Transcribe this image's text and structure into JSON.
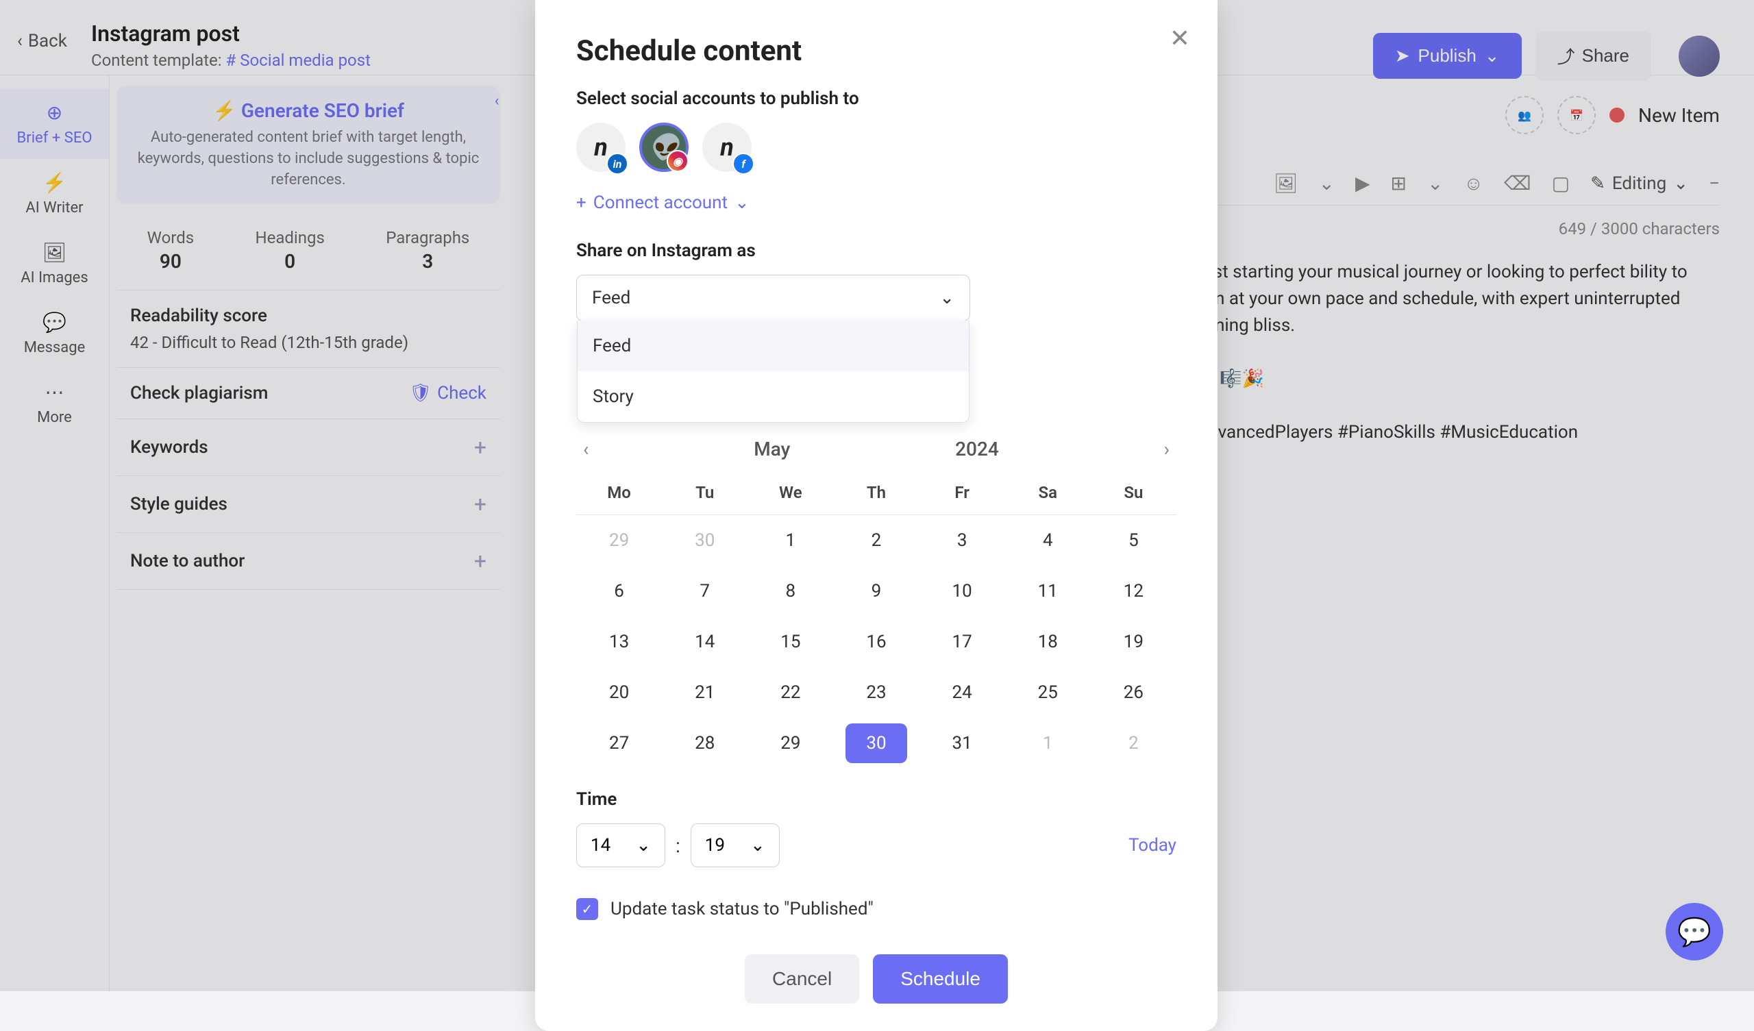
{
  "topbar": {
    "back": "Back",
    "title": "Instagram post",
    "template_label": "Content template:",
    "template_name": "# Social media post",
    "publish": "Publish",
    "share": "Share"
  },
  "left_sidebar": {
    "items": [
      {
        "label": "Brief + SEO"
      },
      {
        "label": "AI Writer"
      },
      {
        "label": "AI Images"
      },
      {
        "label": "Message"
      },
      {
        "label": "More"
      }
    ]
  },
  "seo_panel": {
    "generate_title": "Generate SEO brief",
    "generate_desc": "Auto-generated content brief with target length, keywords, questions to include suggestions & topic references.",
    "stats": {
      "words_label": "Words",
      "words_value": "90",
      "headings_label": "Headings",
      "headings_value": "0",
      "paragraphs_label": "Paragraphs",
      "paragraphs_value": "3"
    },
    "readability_title": "Readability score",
    "readability_text": "42 - Difficult to Read (12th-15th grade)",
    "plagiarism_title": "Check plagiarism",
    "plagiarism_action": "Check",
    "keywords_title": "Keywords",
    "style_title": "Style guides",
    "note_title": "Note to author"
  },
  "right_panel": {
    "new_item": "New Item",
    "editing": "Editing",
    "char_count": "649 / 3000 characters",
    "body1": "e just starting your musical journey or looking to perfect bility to learn at your own pace and schedule, with expert uninterrupted learning bliss.",
    "body2": "her! 🎼🎉",
    "hashtags": "#AdvancedPlayers #PianoSkills #MusicEducation"
  },
  "modal": {
    "title": "Schedule content",
    "select_accounts": "Select social accounts to publish to",
    "connect": "Connect account",
    "share_as_label": "Share on Instagram as",
    "share_as_selected": "Feed",
    "share_as_options": [
      "Feed",
      "Story"
    ],
    "calendar": {
      "month": "May",
      "year": "2024",
      "weekdays": [
        "Mo",
        "Tu",
        "We",
        "Th",
        "Fr",
        "Sa",
        "Su"
      ],
      "weeks": [
        [
          {
            "d": "29",
            "o": true
          },
          {
            "d": "30",
            "o": true
          },
          {
            "d": "1"
          },
          {
            "d": "2"
          },
          {
            "d": "3"
          },
          {
            "d": "4"
          },
          {
            "d": "5"
          }
        ],
        [
          {
            "d": "6"
          },
          {
            "d": "7"
          },
          {
            "d": "8"
          },
          {
            "d": "9"
          },
          {
            "d": "10"
          },
          {
            "d": "11"
          },
          {
            "d": "12"
          }
        ],
        [
          {
            "d": "13"
          },
          {
            "d": "14"
          },
          {
            "d": "15"
          },
          {
            "d": "16"
          },
          {
            "d": "17"
          },
          {
            "d": "18"
          },
          {
            "d": "19"
          }
        ],
        [
          {
            "d": "20"
          },
          {
            "d": "21"
          },
          {
            "d": "22"
          },
          {
            "d": "23"
          },
          {
            "d": "24"
          },
          {
            "d": "25"
          },
          {
            "d": "26"
          }
        ],
        [
          {
            "d": "27"
          },
          {
            "d": "28"
          },
          {
            "d": "29"
          },
          {
            "d": "30",
            "sel": true
          },
          {
            "d": "31"
          },
          {
            "d": "1",
            "o": true
          },
          {
            "d": "2",
            "o": true
          }
        ]
      ]
    },
    "time_label": "Time",
    "time_hour": "14",
    "time_min": "19",
    "today": "Today",
    "update_status": "Update task status to \"Published\"",
    "cancel": "Cancel",
    "schedule": "Schedule"
  }
}
